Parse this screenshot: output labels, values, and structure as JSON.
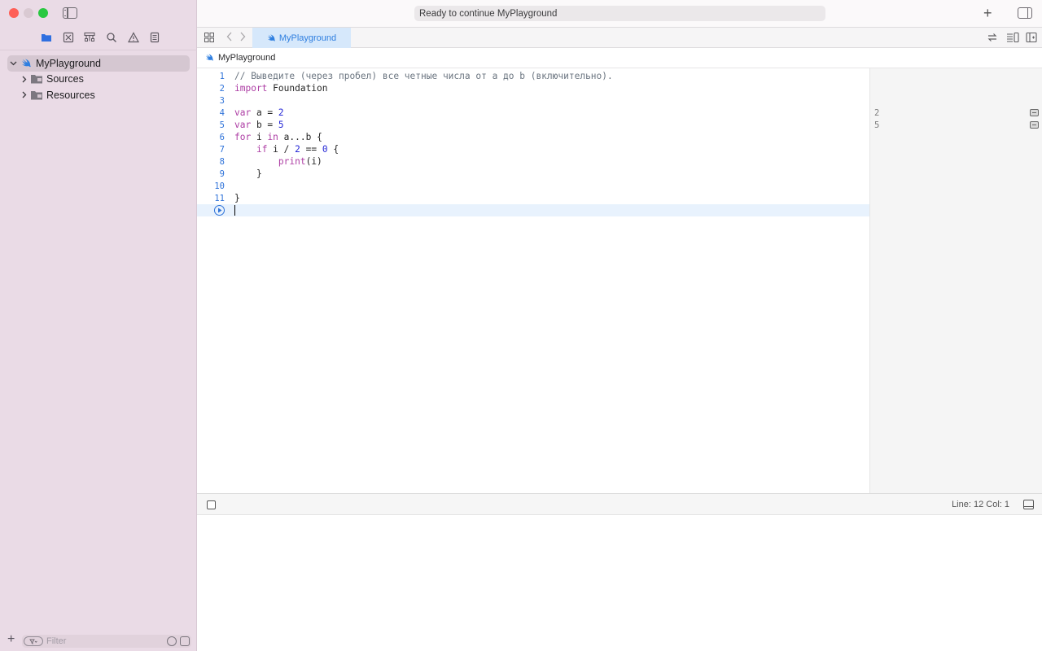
{
  "window": {
    "activity_status": "Ready to continue MyPlayground"
  },
  "sidebar": {
    "nav_tabs": [
      {
        "name": "project-navigator",
        "icon": "folder-icon",
        "active": true
      },
      {
        "name": "source-control-navigator",
        "icon": "source-control-icon"
      },
      {
        "name": "symbol-navigator",
        "icon": "hierarchy-icon"
      },
      {
        "name": "find-navigator",
        "icon": "search-icon"
      },
      {
        "name": "issue-navigator",
        "icon": "warning-icon"
      },
      {
        "name": "test-navigator",
        "icon": "document-icon"
      }
    ],
    "tree": {
      "root": "MyPlayground",
      "children": [
        "Sources",
        "Resources"
      ]
    },
    "filter": {
      "placeholder": "Filter"
    }
  },
  "tabbar": {
    "active_tab": "MyPlayground"
  },
  "jumpbar": {
    "path": "MyPlayground"
  },
  "editor": {
    "lines": [
      {
        "n": "1",
        "text": "// Выведите (через пробел) все четные числа от a до b (включительно)."
      },
      {
        "n": "2",
        "text": "import Foundation"
      },
      {
        "n": "3",
        "text": ""
      },
      {
        "n": "4",
        "text": "var a = 2"
      },
      {
        "n": "5",
        "text": "var b = 5"
      },
      {
        "n": "6",
        "text": "for i in a...b {"
      },
      {
        "n": "7",
        "text": "    if i / 2 == 0 {"
      },
      {
        "n": "8",
        "text": "        print(i)"
      },
      {
        "n": "9",
        "text": "    }"
      },
      {
        "n": "10",
        "text": ""
      },
      {
        "n": "11",
        "text": "}"
      }
    ]
  },
  "results": {
    "values": [
      "2",
      "5"
    ]
  },
  "status": {
    "line_col": "Line: 12  Col: 1"
  },
  "colors": {
    "accent": "#2f7fe0",
    "sidebar_bg": "#eadbe6",
    "keyword": "#ad3da4",
    "number": "#2729d6"
  }
}
